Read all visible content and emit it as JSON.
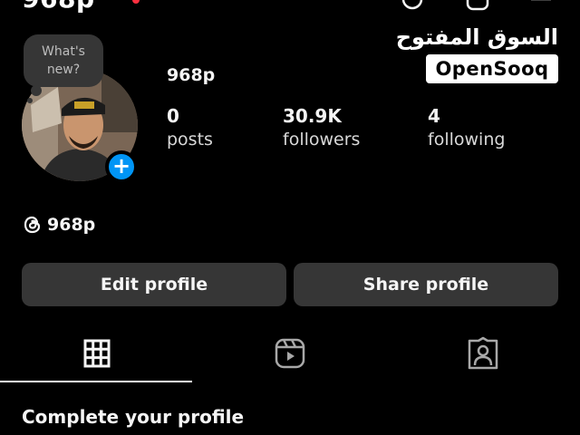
{
  "header": {
    "username": "968p"
  },
  "watermark": {
    "arabic": "السوق المفتوح",
    "brand": "OpenSooq"
  },
  "profile": {
    "note_placeholder": "What's\nnew?",
    "display_name": "968p",
    "add_icon": "plus-icon",
    "stats": [
      {
        "value": "0",
        "label": "posts"
      },
      {
        "value": "30.9K",
        "label": "followers"
      },
      {
        "value": "4",
        "label": "following"
      }
    ],
    "threads_handle": "968p"
  },
  "actions": {
    "edit_label": "Edit profile",
    "share_label": "Share profile"
  },
  "tabs": [
    {
      "icon": "grid-icon",
      "selected": true
    },
    {
      "icon": "reels-icon",
      "selected": false
    },
    {
      "icon": "tagged-icon",
      "selected": false
    }
  ],
  "complete_profile": {
    "title": "Complete your profile"
  },
  "colors": {
    "background": "#000000",
    "button": "#363636",
    "accent": "#0095f6",
    "notification": "#ff3040"
  }
}
